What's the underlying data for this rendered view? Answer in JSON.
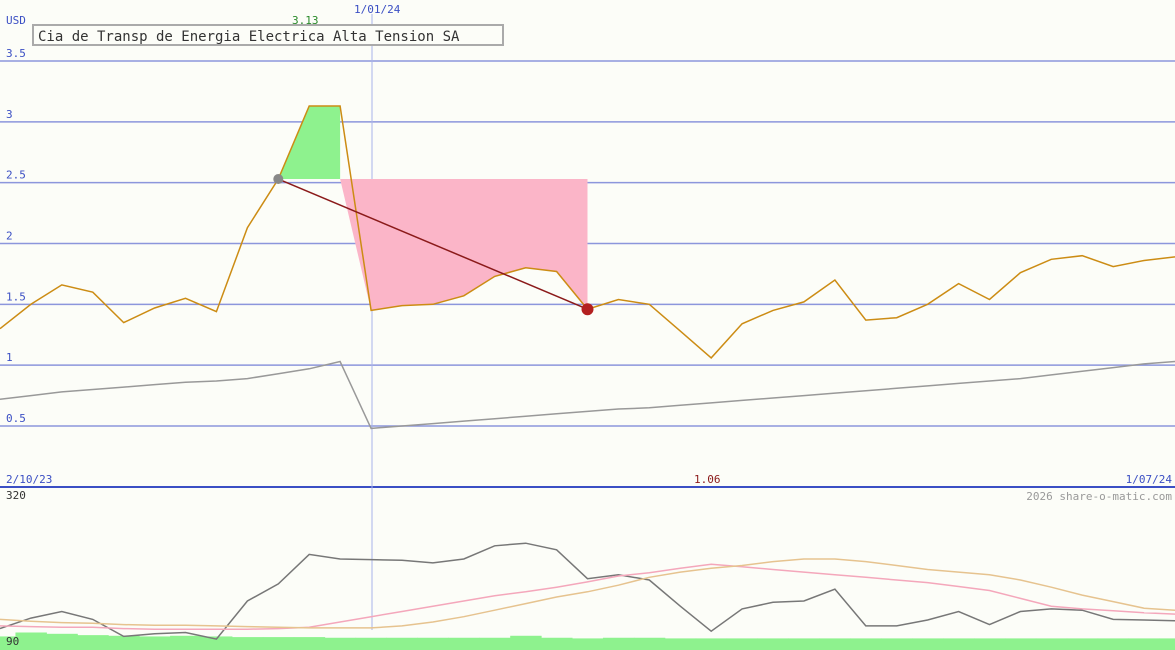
{
  "chart_data": [
    {
      "type": "line",
      "title": "Cia de Transp de Energia Electrica Alta Tension SA",
      "ylabel": "USD",
      "ylim": [
        0.5,
        3.5
      ],
      "y_ticks": [
        "3.5",
        "3",
        "2.5",
        "2",
        "1.5",
        "1",
        "0.5"
      ],
      "x_start_label": "2/10/23",
      "x_end_label": "1/07/24",
      "marker_date_label": "1/01/24",
      "high_label": "3.13",
      "low_label": "1.06",
      "grid": true,
      "series": [
        {
          "values": [
            1.3,
            1.5,
            1.66,
            1.6,
            1.35,
            1.47,
            1.55,
            1.44,
            2.13,
            2.53,
            3.13,
            3.13,
            1.45,
            1.49,
            1.5,
            1.57,
            1.73,
            1.8,
            1.77,
            1.46,
            1.54,
            1.5,
            1.28,
            1.06,
            1.34,
            1.45,
            1.52,
            1.7,
            1.37,
            1.39,
            1.5,
            1.67,
            1.54,
            1.76,
            1.87,
            1.9,
            1.81,
            1.86,
            1.89
          ]
        },
        {
          "values": [
            0.72,
            0.75,
            0.78,
            0.8,
            0.82,
            0.84,
            0.86,
            0.87,
            0.89,
            0.93,
            0.97,
            1.03,
            0.48,
            0.5,
            0.52,
            0.54,
            0.56,
            0.58,
            0.6,
            0.62,
            0.64,
            0.65,
            0.67,
            0.69,
            0.71,
            0.73,
            0.75,
            0.77,
            0.79,
            0.81,
            0.83,
            0.85,
            0.87,
            0.89,
            0.92,
            0.95,
            0.98,
            1.01,
            1.03
          ]
        }
      ]
    },
    {
      "type": "line",
      "ylim": [
        90,
        320
      ],
      "y_ticks": [
        "320",
        "90"
      ],
      "copyright": "2026 share-o-matic.com",
      "series": [
        {
          "values": [
            112,
            128,
            138,
            126,
            100,
            104,
            106,
            96,
            154,
            180,
            225,
            218,
            217,
            216,
            212,
            218,
            238,
            242,
            232,
            188,
            194,
            186,
            146,
            108,
            142,
            152,
            154,
            172,
            116,
            116,
            125,
            138,
            118,
            138,
            142,
            140,
            126,
            125,
            124
          ]
        },
        {
          "values": [
            116,
            115,
            114,
            114,
            112,
            111,
            111,
            111,
            111,
            112,
            114,
            122,
            130,
            138,
            146,
            154,
            162,
            168,
            175,
            183,
            192,
            197,
            204,
            210,
            206,
            202,
            198,
            194,
            190,
            186,
            182,
            176,
            170,
            158,
            146,
            142,
            139,
            136,
            134
          ]
        },
        {
          "values": [
            126,
            123,
            121,
            120,
            118,
            117,
            117,
            116,
            115,
            114,
            113,
            113,
            113,
            116,
            122,
            130,
            140,
            150,
            160,
            168,
            178,
            190,
            198,
            204,
            208,
            214,
            218,
            218,
            214,
            208,
            202,
            198,
            194,
            186,
            175,
            163,
            153,
            143,
            140
          ]
        }
      ],
      "volume": [
        100,
        106,
        104,
        102,
        101,
        100,
        101,
        100,
        99,
        99,
        99,
        98,
        98,
        98,
        98,
        98,
        98,
        101,
        98,
        97,
        98,
        98,
        97,
        97,
        97,
        97,
        97,
        97,
        97,
        97,
        97,
        97,
        97,
        97,
        97,
        97,
        97,
        97,
        97
      ]
    }
  ],
  "colors": {
    "price": "#cc8c14",
    "moving_avg": "#999999",
    "grid": "#8c96dc",
    "axis_label": "#3b4fc4",
    "gain_fill": "#8ef28e",
    "loss_fill": "#fbb5c8",
    "trend_line": "#8b1a1a",
    "vol_line1": "#777777",
    "vol_line2": "#f4a7bb",
    "vol_line3": "#e6c38f",
    "volume_fill": "#8ef28e"
  }
}
